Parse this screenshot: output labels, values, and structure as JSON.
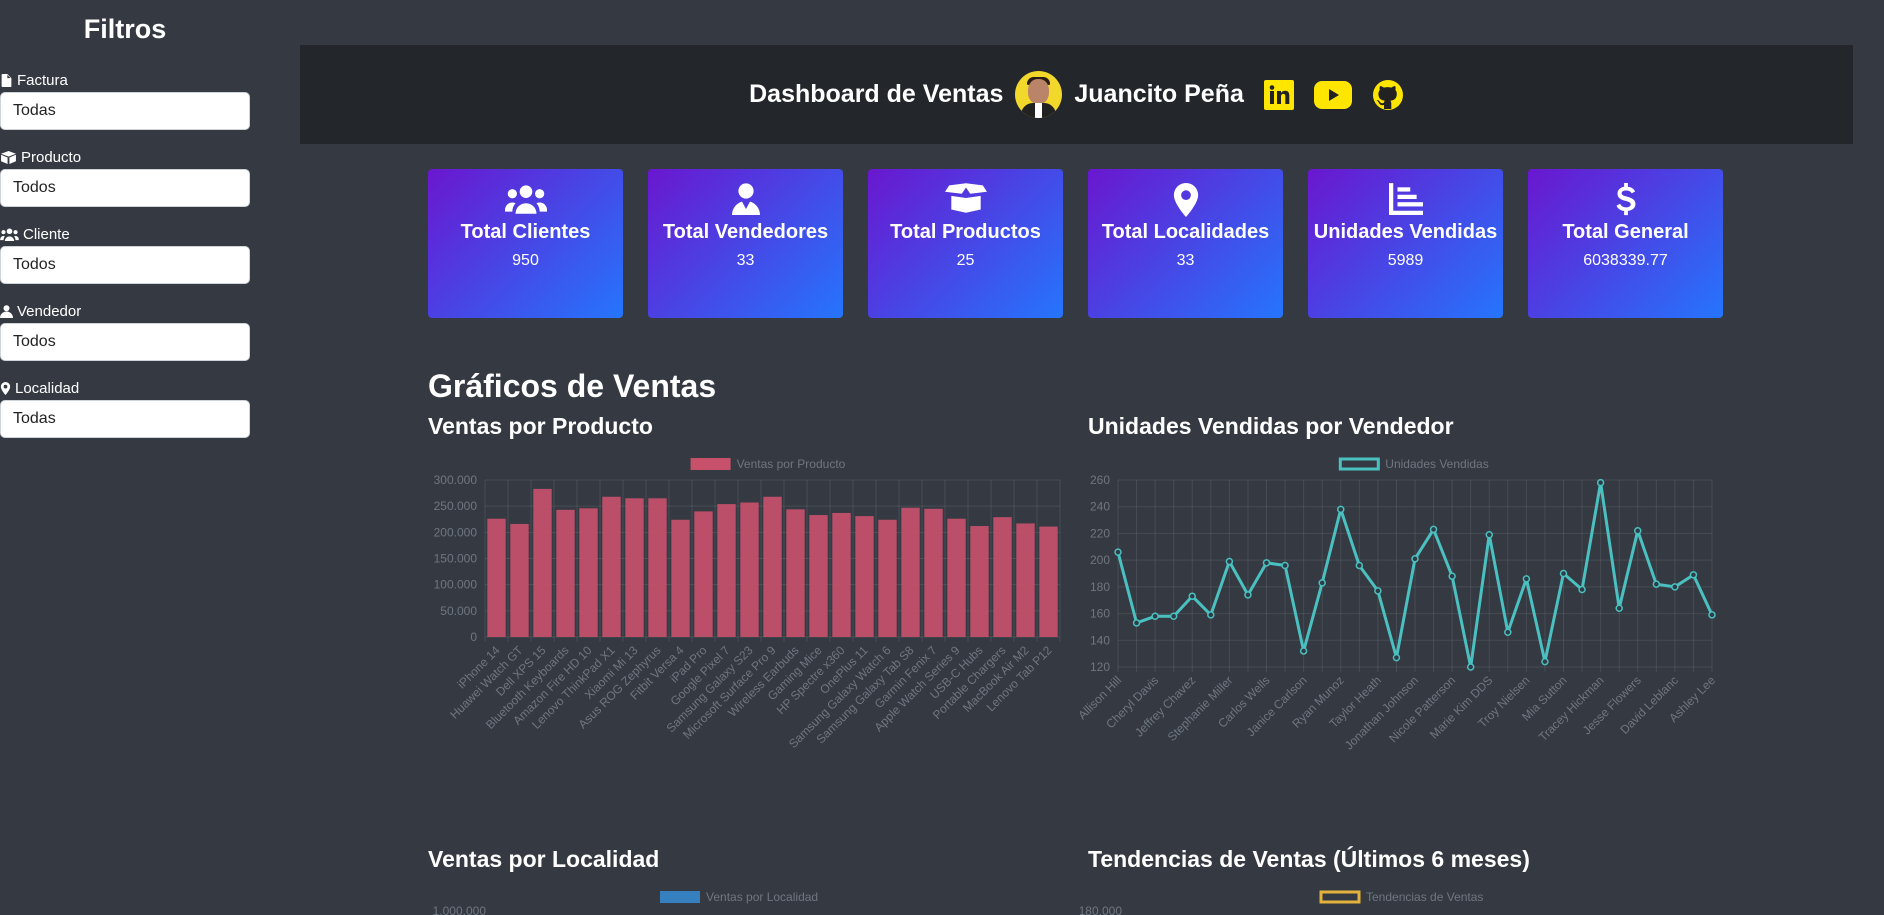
{
  "sidebar": {
    "title": "Filtros",
    "filters": [
      {
        "label": "Factura",
        "value": "Todas",
        "icon": "invoice-icon"
      },
      {
        "label": "Producto",
        "value": "Todos",
        "icon": "box-icon"
      },
      {
        "label": "Cliente",
        "value": "Todos",
        "icon": "users-icon"
      },
      {
        "label": "Vendedor",
        "value": "Todos",
        "icon": "user-icon"
      },
      {
        "label": "Localidad",
        "value": "Todas",
        "icon": "location-icon"
      }
    ]
  },
  "header": {
    "title": "Dashboard de Ventas",
    "author": "Juancito Peña",
    "social": [
      "linkedin-icon",
      "youtube-icon",
      "github-icon"
    ],
    "accent": "#ffe600"
  },
  "cards": [
    {
      "title": "Total Clientes",
      "value": "950",
      "icon": "users-icon"
    },
    {
      "title": "Total Vendedores",
      "value": "33",
      "icon": "user-tie-icon"
    },
    {
      "title": "Total Productos",
      "value": "25",
      "icon": "box-open-icon"
    },
    {
      "title": "Total Localidades",
      "value": "33",
      "icon": "location-icon"
    },
    {
      "title": "Unidades Vendidas",
      "value": "5989",
      "icon": "chart-bars-icon"
    },
    {
      "title": "Total General",
      "value": "6038339.77",
      "icon": "dollar-icon"
    }
  ],
  "section": {
    "title": "Gráficos de Ventas"
  },
  "charts": {
    "producto_title": "Ventas por Producto",
    "vendedor_title": "Unidades Vendidas por Vendedor",
    "localidad_title": "Ventas por Localidad",
    "tendencias_title": "Tendencias de Ventas (Últimos 6 meses)"
  },
  "chart_data": [
    {
      "type": "bar",
      "title": "Ventas por Producto",
      "legend": "Ventas por Producto",
      "color": "#c7506b",
      "ylim": [
        0,
        300000
      ],
      "yticks": [
        "0",
        "50.000",
        "100.000",
        "150.000",
        "200.000",
        "250.000",
        "300.000"
      ],
      "categories": [
        "iPhone 14",
        "Huawei Watch GT",
        "Dell XPS 15",
        "Bluetooth Keyboards",
        "Amazon Fire HD 10",
        "Lenovo ThinkPad X1",
        "Xiaomi Mi 13",
        "Asus ROG Zephyrus",
        "Fitbit Versa 4",
        "iPad Pro",
        "Google Pixel 7",
        "Samsung Galaxy S23",
        "Microsoft Surface Pro 9",
        "Wireless Earbuds",
        "Gaming Mice",
        "HP Spectre x360",
        "OnePlus 11",
        "Samsung Galaxy Watch 6",
        "Samsung Galaxy Tab S8",
        "Garmin Fenix 7",
        "Apple Watch Series 9",
        "USB-C Hubs",
        "Portable Chargers",
        "MacBook Air M2",
        "Lenovo Tab P12"
      ],
      "values": [
        226000,
        216000,
        283000,
        243000,
        246000,
        268000,
        265000,
        265000,
        224000,
        240000,
        254000,
        257000,
        268000,
        244000,
        233000,
        237000,
        231000,
        224000,
        247000,
        245000,
        226000,
        212000,
        229000,
        217000,
        211000
      ]
    },
    {
      "type": "line",
      "title": "Unidades Vendidas por Vendedor",
      "legend": "Unidades Vendidas",
      "color": "#4bc0c0",
      "ylim": [
        120,
        260
      ],
      "yticks": [
        "120",
        "140",
        "160",
        "180",
        "200",
        "220",
        "240",
        "260"
      ],
      "x_labels": [
        "Allison Hill",
        "Cheryl Davis",
        "Jeffrey Chavez",
        "Stephanie Miller",
        "Carlos Wells",
        "Janice Carlson",
        "Ryan Munoz",
        "Taylor Heath",
        "Jonathan Johnson",
        "Nicole Patterson",
        "Marie Kim DDS",
        "Troy Nielsen",
        "Mia Sutton",
        "Tracey Hickman",
        "Jesse Flowers",
        "David Leblanc",
        "Ashley Lee"
      ],
      "values": [
        206,
        153,
        158,
        158,
        173,
        159,
        199,
        174,
        198,
        196,
        132,
        183,
        238,
        196,
        177,
        127,
        201,
        223,
        188,
        120,
        219,
        146,
        186,
        124,
        190,
        178,
        258,
        164,
        222,
        182,
        180,
        189,
        159
      ]
    },
    {
      "type": "bar",
      "title": "Ventas por Localidad",
      "legend": "Ventas por Localidad",
      "color": "#3680c0",
      "yticks": [
        "1.000.000"
      ]
    },
    {
      "type": "line",
      "title": "Tendencias de Ventas (Últimos 6 meses)",
      "legend": "Tendencias de Ventas",
      "color": "#e3b23c",
      "yticks": [
        "180.000"
      ]
    }
  ]
}
